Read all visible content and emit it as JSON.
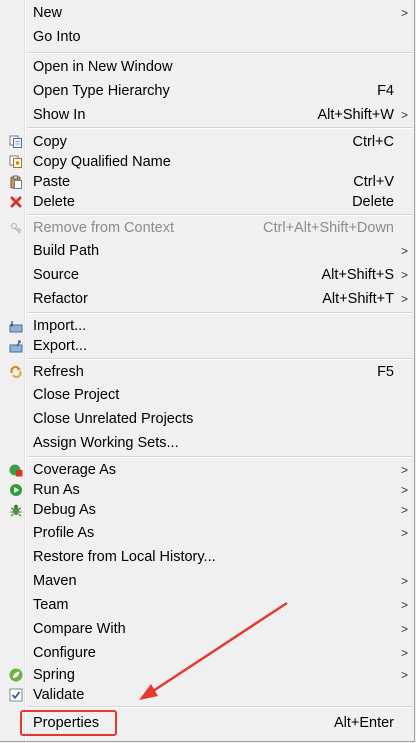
{
  "menu": {
    "items": [
      {
        "label": "New",
        "shortcut": "",
        "submenu": true,
        "icon": "",
        "disabled": false
      },
      {
        "label": "Go Into",
        "shortcut": "",
        "submenu": false,
        "icon": "",
        "disabled": false
      },
      {
        "label": "Open in New Window",
        "shortcut": "",
        "submenu": false,
        "icon": "",
        "disabled": false
      },
      {
        "label": "Open Type Hierarchy",
        "shortcut": "F4",
        "submenu": false,
        "icon": "",
        "disabled": false
      },
      {
        "label": "Show In",
        "shortcut": "Alt+Shift+W",
        "submenu": true,
        "icon": "",
        "disabled": false
      },
      {
        "label": "Copy",
        "shortcut": "Ctrl+C",
        "submenu": false,
        "icon": "copy-icon",
        "disabled": false
      },
      {
        "label": "Copy Qualified Name",
        "shortcut": "",
        "submenu": false,
        "icon": "copy-qualified-name-icon",
        "disabled": false
      },
      {
        "label": "Paste",
        "shortcut": "Ctrl+V",
        "submenu": false,
        "icon": "paste-icon",
        "disabled": false
      },
      {
        "label": "Delete",
        "shortcut": "Delete",
        "submenu": false,
        "icon": "delete-icon",
        "disabled": false
      },
      {
        "label": "Remove from Context",
        "shortcut": "Ctrl+Alt+Shift+Down",
        "submenu": false,
        "icon": "remove-context-icon",
        "disabled": true
      },
      {
        "label": "Build Path",
        "shortcut": "",
        "submenu": true,
        "icon": "",
        "disabled": false
      },
      {
        "label": "Source",
        "shortcut": "Alt+Shift+S",
        "submenu": true,
        "icon": "",
        "disabled": false
      },
      {
        "label": "Refactor",
        "shortcut": "Alt+Shift+T",
        "submenu": true,
        "icon": "",
        "disabled": false
      },
      {
        "label": "Import...",
        "shortcut": "",
        "submenu": false,
        "icon": "import-icon",
        "disabled": false
      },
      {
        "label": "Export...",
        "shortcut": "",
        "submenu": false,
        "icon": "export-icon",
        "disabled": false
      },
      {
        "label": "Refresh",
        "shortcut": "F5",
        "submenu": false,
        "icon": "refresh-icon",
        "disabled": false
      },
      {
        "label": "Close Project",
        "shortcut": "",
        "submenu": false,
        "icon": "",
        "disabled": false
      },
      {
        "label": "Close Unrelated Projects",
        "shortcut": "",
        "submenu": false,
        "icon": "",
        "disabled": false
      },
      {
        "label": "Assign Working Sets...",
        "shortcut": "",
        "submenu": false,
        "icon": "",
        "disabled": false
      },
      {
        "label": "Coverage As",
        "shortcut": "",
        "submenu": true,
        "icon": "coverage-icon",
        "disabled": false
      },
      {
        "label": "Run As",
        "shortcut": "",
        "submenu": true,
        "icon": "run-icon",
        "disabled": false
      },
      {
        "label": "Debug As",
        "shortcut": "",
        "submenu": true,
        "icon": "debug-bug-icon",
        "disabled": false
      },
      {
        "label": "Profile As",
        "shortcut": "",
        "submenu": true,
        "icon": "",
        "disabled": false
      },
      {
        "label": "Restore from Local History...",
        "shortcut": "",
        "submenu": false,
        "icon": "",
        "disabled": false
      },
      {
        "label": "Maven",
        "shortcut": "",
        "submenu": true,
        "icon": "",
        "disabled": false
      },
      {
        "label": "Team",
        "shortcut": "",
        "submenu": true,
        "icon": "",
        "disabled": false
      },
      {
        "label": "Compare With",
        "shortcut": "",
        "submenu": true,
        "icon": "",
        "disabled": false
      },
      {
        "label": "Configure",
        "shortcut": "",
        "submenu": true,
        "icon": "",
        "disabled": false
      },
      {
        "label": "Spring",
        "shortcut": "",
        "submenu": true,
        "icon": "spring-leaf-icon",
        "disabled": false
      },
      {
        "label": "Validate",
        "shortcut": "",
        "submenu": false,
        "icon": "validate-check-icon",
        "disabled": false
      },
      {
        "label": "Properties",
        "shortcut": "Alt+Enter",
        "submenu": false,
        "icon": "",
        "disabled": false
      }
    ]
  },
  "submenu_arrow": ">",
  "colors": {
    "background": "#f0f0f0",
    "disabled_text": "#8c8c8c",
    "annotation_red": "#e23a2e",
    "delete_red": "#d9342b",
    "run_green": "#2e9d3a",
    "spring_green": "#6db33f"
  }
}
